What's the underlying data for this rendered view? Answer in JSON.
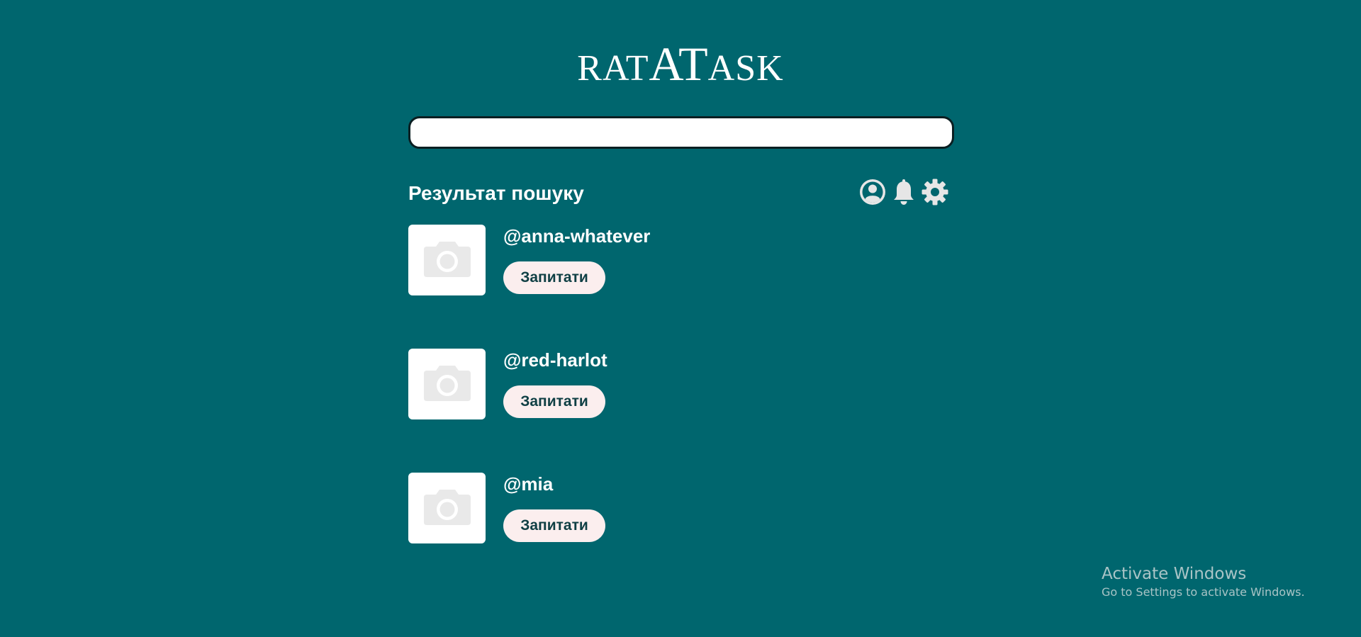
{
  "app": {
    "logo": {
      "part1": "RAT",
      "part2": "AT",
      "part3": "ASK"
    }
  },
  "search": {
    "value": "",
    "placeholder": ""
  },
  "results": {
    "title": "Результат пошуку",
    "items": [
      {
        "username": "@anna-whatever",
        "button_label": "Запитати"
      },
      {
        "username": "@red-harlot",
        "button_label": "Запитати"
      },
      {
        "username": "@mia",
        "button_label": "Запитати"
      }
    ]
  },
  "header_icons": [
    "user-icon",
    "bell-icon",
    "gear-icon"
  ],
  "colors": {
    "background": "#00666e",
    "button_bg": "#fbeeee",
    "button_text": "#0f3f44",
    "icon": "#e6e6e6",
    "avatar_placeholder": "#e9e9e9"
  },
  "watermark": {
    "title": "Activate Windows",
    "subtitle": "Go to Settings to activate Windows."
  }
}
